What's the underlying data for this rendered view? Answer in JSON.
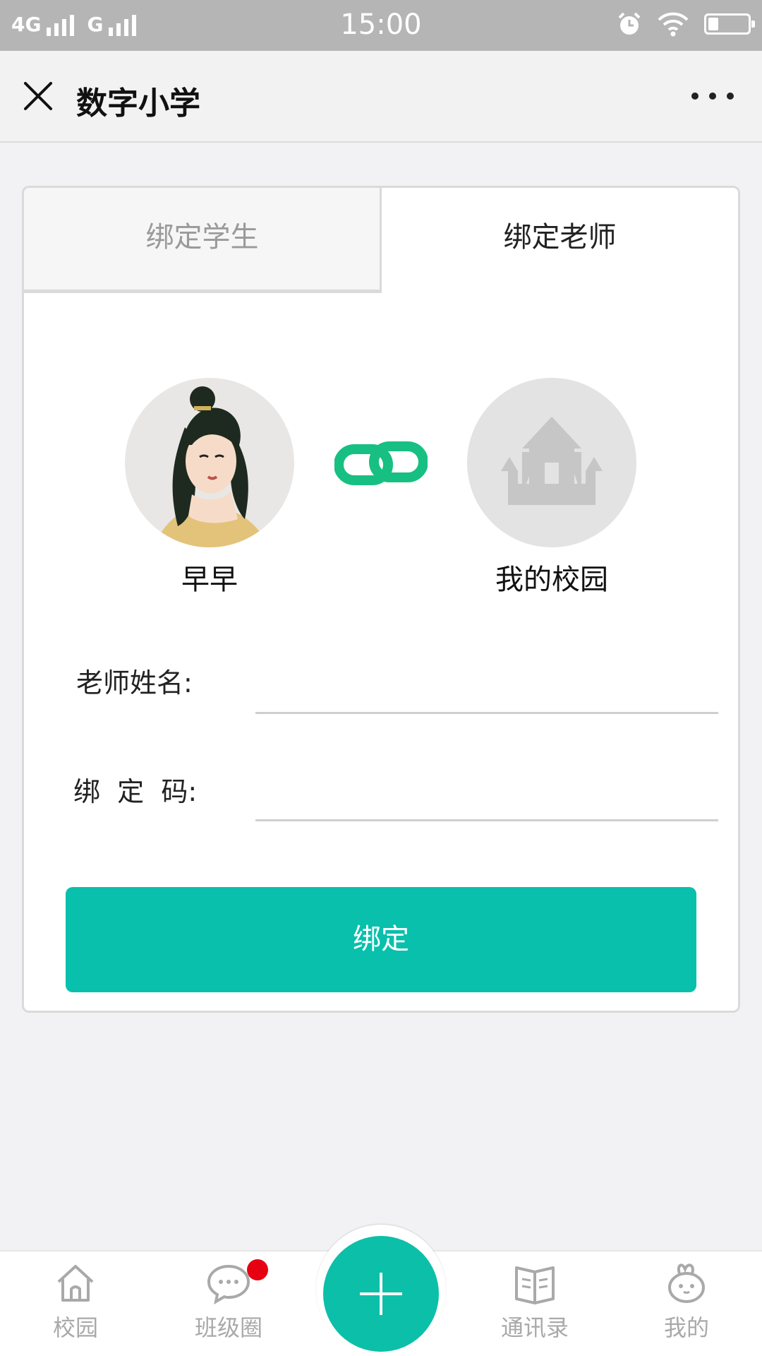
{
  "status_bar": {
    "network_1": "4G",
    "network_2": "G",
    "time": "15:00",
    "icons": [
      "signal-icon",
      "alarm-icon",
      "wifi-icon",
      "battery-icon"
    ]
  },
  "navbar": {
    "title": "数字小学",
    "close_icon": "close-icon",
    "more_icon": "more-icon"
  },
  "tabs": [
    {
      "label": "绑定学生",
      "active": false
    },
    {
      "label": "绑定老师",
      "active": true
    }
  ],
  "binding": {
    "user_name": "早早",
    "campus_name": "我的校园",
    "link_icon": "link-icon",
    "link_color": "#17c082"
  },
  "form": {
    "teacher_name_label": "老师姓名:",
    "teacher_name_value": "",
    "bind_code_label": "绑  定  码:",
    "bind_code_value": "",
    "submit_label": "绑定"
  },
  "tabbar": {
    "items": [
      {
        "label": "校园",
        "icon": "home-icon"
      },
      {
        "label": "班级圈",
        "icon": "chat-icon",
        "badge": true
      },
      {
        "label": "",
        "icon": "plus-icon"
      },
      {
        "label": "通讯录",
        "icon": "book-icon"
      },
      {
        "label": "我的",
        "icon": "profile-icon"
      }
    ]
  },
  "colors": {
    "accent": "#08c0ab",
    "badge": "#e60012",
    "status_bar": "#b5b5b5"
  }
}
